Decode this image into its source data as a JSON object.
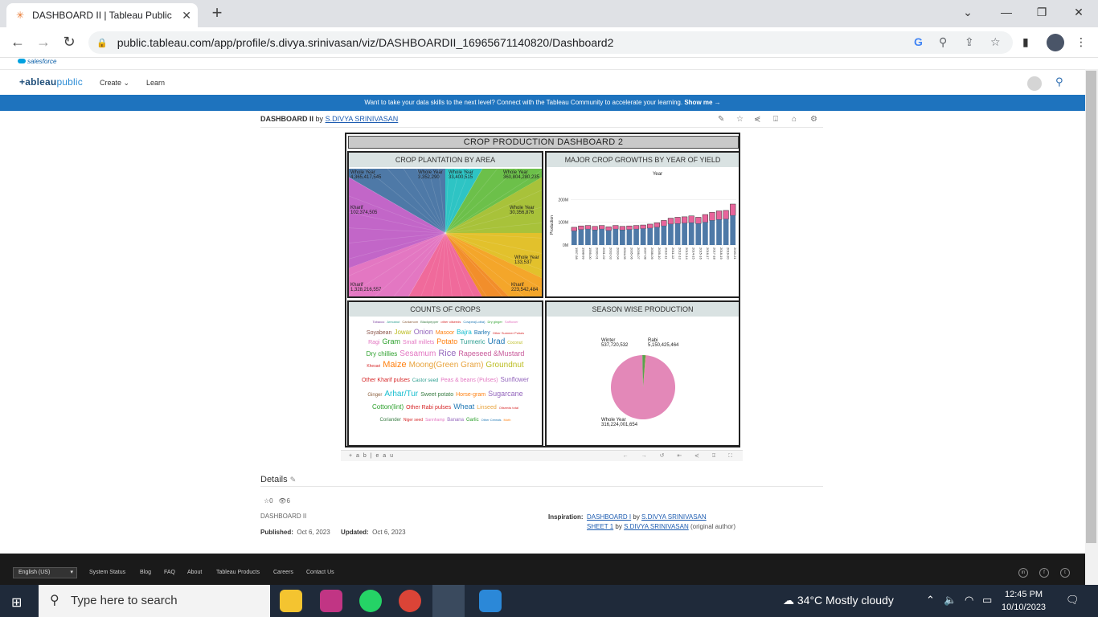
{
  "browser": {
    "tab_title": "DASHBOARD II | Tableau Public",
    "url": "public.tableau.com/app/profile/s.divya.srinivasan/viz/DASHBOARDII_16965671140820/Dashboard2",
    "bookmark": "salesforce"
  },
  "tableau": {
    "logo": "+ableau",
    "logo_public": "public",
    "nav": [
      "Create",
      "Learn"
    ],
    "banner_text": "Want to take your data skills to the next level? Connect with the Tableau Community to accelerate your learning.",
    "banner_link": "Show me →",
    "viz_name": "DASHBOARD II",
    "by": "by",
    "author": "S.DIVYA SRINIVASAN"
  },
  "dashboard": {
    "title": "CROP  PRODUCTION  DASHBOARD 2",
    "panel1_title": "CROP PLANTATION BY AREA",
    "panel2_title": "MAJOR CROP GROWTHS BY YEAR OF YIELD",
    "panel3_title": "COUNTS OF CROPS",
    "panel4_title": "SEASON WISE PRODUCTION",
    "p1_labels": [
      {
        "season": "Whole Year",
        "value": "4,365,417,545"
      },
      {
        "season": "Whole Year",
        "value": "3,352,290"
      },
      {
        "season": "Whole Year",
        "value": "33,400,515"
      },
      {
        "season": "Whole Year",
        "value": "360,804,280,235"
      },
      {
        "season": "Kharif",
        "value": "102,374,505"
      },
      {
        "season": "Whole Year",
        "value": "30,356,876"
      },
      {
        "season": "Whole Year",
        "value": "133,537"
      },
      {
        "season": "Kharif",
        "value": "1,328,216,557"
      },
      {
        "season": "Kharif",
        "value": "223,542,484"
      }
    ],
    "wordcloud": [
      {
        "w": "Tobacco",
        "c": "#7b3f9e"
      },
      {
        "w": "Arecanut",
        "c": "#2a9d8f"
      },
      {
        "w": "Cardamom",
        "c": "#8b5e3c"
      },
      {
        "w": "Blackpepper",
        "c": "#3a7d44"
      },
      {
        "w": "other oilseeds",
        "c": "#d62728"
      },
      {
        "w": "Cowpea(Lobia)",
        "c": "#1f77b4"
      },
      {
        "w": "Dry ginger",
        "c": "#2ca02c"
      },
      {
        "w": "Safflower",
        "c": "#e377c2"
      },
      {
        "w": "Soyabean",
        "c": "#8c564b"
      },
      {
        "w": "Jowar",
        "c": "#bcbd22"
      },
      {
        "w": "Onion",
        "c": "#9467bd"
      },
      {
        "w": "Masoor",
        "c": "#ff7f0e"
      },
      {
        "w": "Bajra",
        "c": "#17becf"
      },
      {
        "w": "Barley",
        "c": "#1f77b4"
      },
      {
        "w": "Other Summer Pulses",
        "c": "#d62728"
      },
      {
        "w": "Ragi",
        "c": "#e377c2"
      },
      {
        "w": "Gram",
        "c": "#2ca02c"
      },
      {
        "w": "Small millets",
        "c": "#e377c2"
      },
      {
        "w": "Potato",
        "c": "#ff7f0e"
      },
      {
        "w": "Turmeric",
        "c": "#2a9d8f"
      },
      {
        "w": "Urad",
        "c": "#1f77b4"
      },
      {
        "w": "Coconut",
        "c": "#bcbd22"
      },
      {
        "w": "Dry chillies",
        "c": "#2ca02c"
      },
      {
        "w": "Sesamum",
        "c": "#e377c2"
      },
      {
        "w": "Rice",
        "c": "#9467bd"
      },
      {
        "w": "Rapeseed &Mustard",
        "c": "#c85a9a"
      },
      {
        "w": "Khesari",
        "c": "#d62728"
      },
      {
        "w": "Maize",
        "c": "#ff7f0e"
      },
      {
        "w": "Moong(Green Gram)",
        "c": "#e8a33d"
      },
      {
        "w": "Groundnut",
        "c": "#bcbd22"
      },
      {
        "w": "Other Kharif pulses",
        "c": "#d62728"
      },
      {
        "w": "Castor seed",
        "c": "#2a9d8f"
      },
      {
        "w": "Peas & beans (Pulses)",
        "c": "#e377c2"
      },
      {
        "w": "Sunflower",
        "c": "#9467bd"
      },
      {
        "w": "Ginger",
        "c": "#8b5e3c"
      },
      {
        "w": "Arhar/Tur",
        "c": "#17becf"
      },
      {
        "w": "Sweet potato",
        "c": "#3a7d44"
      },
      {
        "w": "Horse-gram",
        "c": "#ff7f0e"
      },
      {
        "w": "Sugarcane",
        "c": "#9467bd"
      },
      {
        "w": "Cotton(lint)",
        "c": "#2ca02c"
      },
      {
        "w": "Other Rabi pulses",
        "c": "#d62728"
      },
      {
        "w": "Wheat",
        "c": "#1f77b4"
      },
      {
        "w": "Linseed",
        "c": "#e8a33d"
      },
      {
        "w": "Oilseeds total",
        "c": "#d62728"
      },
      {
        "w": "Coriander",
        "c": "#3a7d44"
      },
      {
        "w": "Niger seed",
        "c": "#d62728"
      },
      {
        "w": "Sannhamp",
        "c": "#e377c2"
      },
      {
        "w": "Banana",
        "c": "#9467bd"
      },
      {
        "w": "Garlic",
        "c": "#2ca02c"
      },
      {
        "w": "Other Cereals",
        "c": "#1f77b4"
      },
      {
        "w": "Moth",
        "c": "#ff7f0e"
      }
    ],
    "p4_labels": [
      {
        "season": "Winter",
        "value": "537,720,532"
      },
      {
        "season": "Rabi",
        "value": "5,150,425,464"
      },
      {
        "season": "Whole Year",
        "value": "316,224,001,654"
      }
    ]
  },
  "chart_data": [
    {
      "type": "bar",
      "title": "MAJOR CROP GROWTHS BY YEAR OF YIELD",
      "header": "Year",
      "ylabel": "Production",
      "ylim": [
        0,
        300
      ],
      "yticks": [
        "0M",
        "100M",
        "200M"
      ],
      "categories": [
        "1997-98",
        "1998-99",
        "1999-00",
        "2000-01",
        "2001-02",
        "2002-03",
        "2003-04",
        "2004-05",
        "2005-06",
        "2006-07",
        "2007-08",
        "2008-09",
        "2009-10",
        "2010-11",
        "2011-12",
        "2012-13",
        "2013-14",
        "2014-15",
        "2015-16",
        "2016-17",
        "2017-18",
        "2018-19",
        "2019-20",
        "2020-21"
      ],
      "series": [
        {
          "color": "#4e79a7",
          "values": [
            62,
            68,
            70,
            66,
            70,
            64,
            70,
            66,
            68,
            70,
            72,
            74,
            78,
            84,
            92,
            94,
            96,
            98,
            94,
            100,
            108,
            112,
            114,
            130
          ]
        },
        {
          "color": "#e8649b",
          "values": [
            78,
            84,
            86,
            82,
            86,
            80,
            86,
            82,
            84,
            86,
            88,
            92,
            98,
            108,
            118,
            122,
            124,
            128,
            122,
            134,
            144,
            150,
            152,
            180
          ]
        }
      ]
    },
    {
      "type": "pie",
      "title": "SEASON WISE PRODUCTION",
      "slices": [
        {
          "label": "Whole Year",
          "value": 316224001654,
          "color": "#e388b8"
        },
        {
          "label": "Rabi",
          "value": 5150425464,
          "color": "#59a14f"
        },
        {
          "label": "Winter",
          "value": 537720532,
          "color": "#f28e2b"
        }
      ]
    }
  ],
  "viz_toolbar": "+ a b | e a u",
  "details": {
    "heading": "Details",
    "favorites": "0",
    "views": "6",
    "name": "DASHBOARD II",
    "published_label": "Published:",
    "published": "Oct 6, 2023",
    "updated_label": "Updated:",
    "updated": "Oct 6, 2023",
    "inspiration_label": "Inspiration:",
    "insp1_viz": "DASHBOARD I",
    "insp1_author": "S.DIVYA SRINIVASAN",
    "insp2_viz": "SHEET 1",
    "insp2_author": "S.DIVYA SRINIVASAN",
    "insp2_note": "(original author)"
  },
  "footer": {
    "language": "English (US)",
    "links": [
      "System Status",
      "Blog",
      "FAQ",
      "About",
      "Tableau Products",
      "Careers",
      "Contact Us"
    ]
  },
  "taskbar": {
    "search_placeholder": "Type here to search",
    "weather": "34°C  Mostly cloudy",
    "time": "12:45 PM",
    "date": "10/10/2023"
  }
}
